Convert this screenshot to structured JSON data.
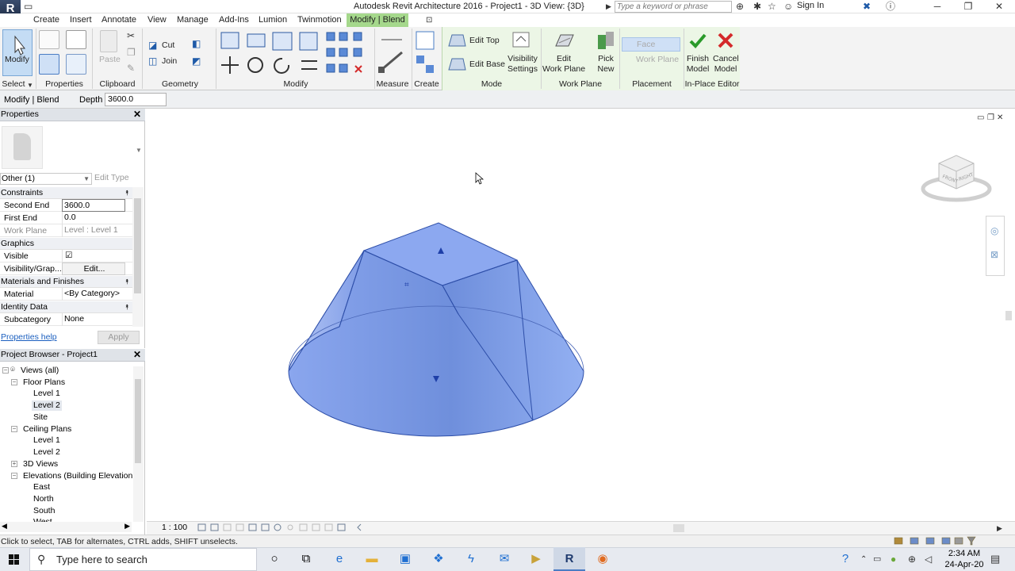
{
  "window": {
    "title": "Autodesk Revit Architecture 2016 -    Project1 - 3D View: {3D}",
    "search_placeholder": "Type a keyword or phrase",
    "signin": "Sign In"
  },
  "ribbon_tabs": [
    "Create",
    "Insert",
    "Annotate",
    "View",
    "Manage",
    "Add-Ins",
    "Lumion",
    "Twinmotion"
  ],
  "active_tab": "Modify | Blend",
  "ribbon": {
    "select": {
      "button": "Modify",
      "pane": "Select"
    },
    "properties_pane": "Properties",
    "clipboard": {
      "pane": "Clipboard",
      "paste": "Paste"
    },
    "geometry": {
      "pane": "Geometry",
      "cut": "Cut",
      "join": "Join"
    },
    "modify_pane": "Modify",
    "measure_pane": "Measure",
    "create_pane": "Create",
    "mode": {
      "pane": "Mode",
      "edit_top": "Edit Top",
      "edit_base": "Edit Base",
      "visibility_settings_1": "Visibility",
      "visibility_settings_2": "Settings"
    },
    "work_plane": {
      "pane": "Work Plane",
      "edit_1": "Edit",
      "edit_2": "Work Plane",
      "pick_1": "Pick",
      "pick_2": "New"
    },
    "placement": {
      "pane": "Placement",
      "face": "Face",
      "work_plane": "Work Plane"
    },
    "inplace": {
      "pane": "In-Place Editor",
      "finish_1": "Finish",
      "finish_2": "Model",
      "cancel_1": "Cancel",
      "cancel_2": "Model"
    },
    "colors": {
      "finish": "#2a9a2a",
      "cancel": "#d42a2a",
      "context_tab": "#a5d88c"
    }
  },
  "options_bar": {
    "title": "Modify | Blend",
    "depth_label": "Depth",
    "depth_value": "3600.0"
  },
  "properties": {
    "header": "Properties",
    "type_selector": "Other (1)",
    "edit_type": "Edit Type",
    "groups": {
      "constraints": "Constraints",
      "graphics": "Graphics",
      "materials": "Materials and Finishes",
      "identity": "Identity Data"
    },
    "rows": {
      "second_end": {
        "label": "Second End",
        "value": "3600.0"
      },
      "first_end": {
        "label": "First End",
        "value": "0.0"
      },
      "work_plane": {
        "label": "Work Plane",
        "value": "Level : Level 1"
      },
      "visible": {
        "label": "Visible",
        "value": "☑"
      },
      "visibility": {
        "label": "Visibility/Grap...",
        "value": "Edit..."
      },
      "material": {
        "label": "Material",
        "value": "<By Category>"
      },
      "subcategory": {
        "label": "Subcategory",
        "value": "None"
      }
    },
    "help": "Properties help",
    "apply": "Apply"
  },
  "browser": {
    "header": "Project Browser - Project1",
    "items": [
      {
        "label": "Views (all)"
      },
      {
        "label": "Floor Plans"
      },
      {
        "label": "Level 1"
      },
      {
        "label": "Level 2"
      },
      {
        "label": "Site"
      },
      {
        "label": "Ceiling Plans"
      },
      {
        "label": "Level 1"
      },
      {
        "label": "Level 2"
      },
      {
        "label": "3D Views"
      },
      {
        "label": "Elevations (Building Elevation"
      },
      {
        "label": "East"
      },
      {
        "label": "North"
      },
      {
        "label": "South"
      },
      {
        "label": "West"
      }
    ],
    "selected_index": 3
  },
  "viewcube": {
    "front": "FRONT",
    "right": "RIGHT"
  },
  "viewbar": {
    "scale": "1 : 100"
  },
  "status": {
    "text": "Click to select, TAB for alternates, CTRL adds, SHIFT unselects."
  },
  "taskbar": {
    "search": "Type here to search",
    "time": "2:34 AM",
    "date": "24-Apr-20"
  },
  "model_color": "#7b9ce8"
}
